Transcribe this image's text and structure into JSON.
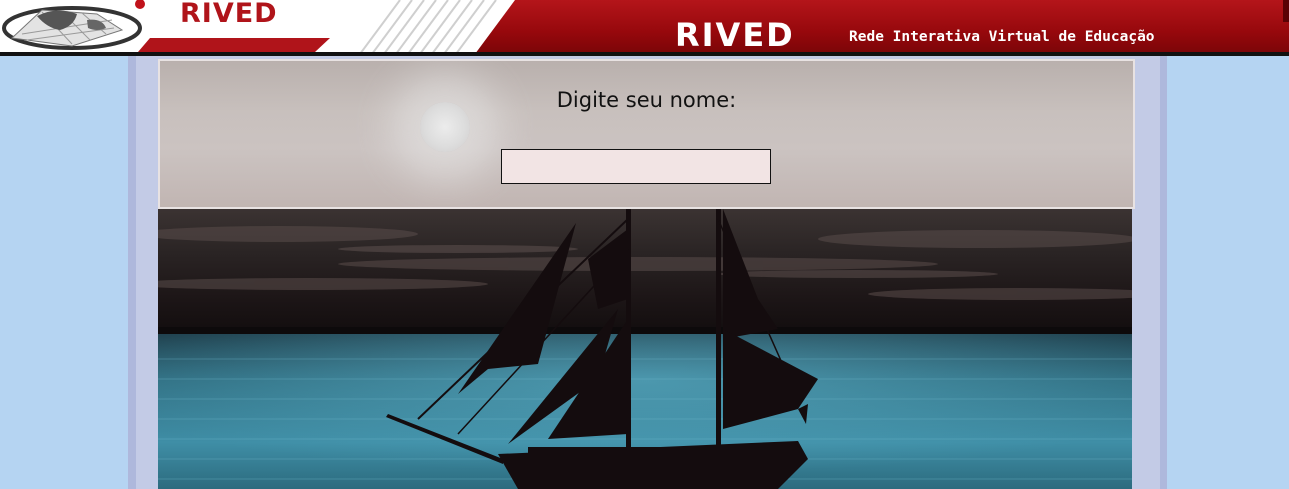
{
  "header": {
    "brand_small": "RIVED",
    "brand_big": "RIVED",
    "subtitle": "Rede Interativa Virtual de Educação"
  },
  "form": {
    "prompt_label": "Digite seu nome:",
    "name_value": ""
  },
  "colors": {
    "banner_red": "#a00b10",
    "page_background": "#b5d4f2",
    "frame_blue": "#aeb8dc",
    "input_fill": "#f2e4e4"
  },
  "icons": {
    "logo": "rived-globe-logo",
    "scene": "sailing-ship-silhouette-at-night"
  }
}
